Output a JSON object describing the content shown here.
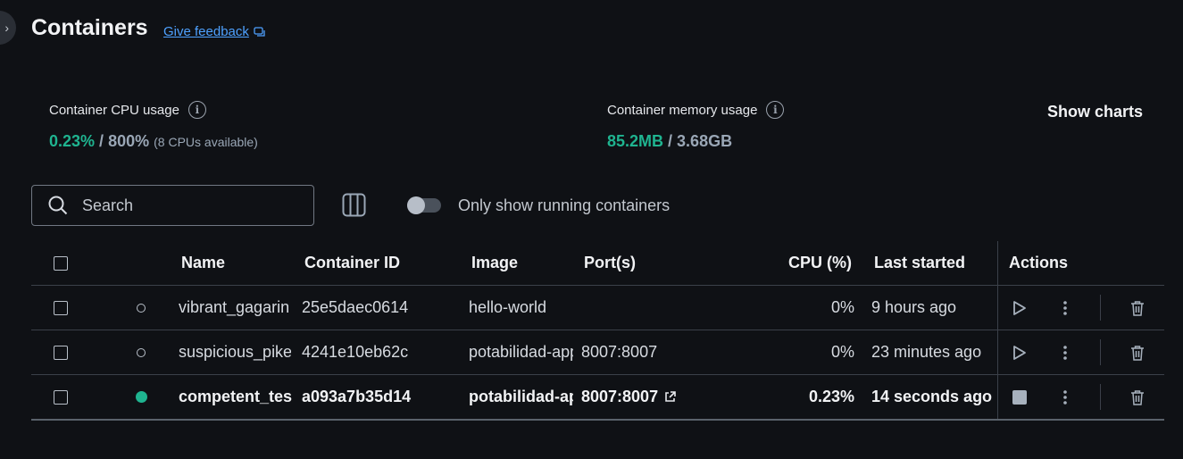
{
  "header": {
    "title": "Containers",
    "feedback_label": "Give feedback"
  },
  "stats": {
    "cpu": {
      "label": "Container CPU usage",
      "used": "0.23%",
      "separator": " / ",
      "total": "800%",
      "note": "(8 CPUs available)"
    },
    "memory": {
      "label": "Container memory usage",
      "used": "85.2MB",
      "separator": " / ",
      "total": "3.68GB"
    },
    "show_charts_label": "Show charts"
  },
  "toolbar": {
    "search_placeholder": "Search",
    "toggle_label": "Only show running containers",
    "toggle_on": false
  },
  "table": {
    "columns": {
      "name": "Name",
      "container_id": "Container ID",
      "image": "Image",
      "ports": "Port(s)",
      "cpu": "CPU (%)",
      "last_started": "Last started",
      "actions": "Actions"
    },
    "rows": [
      {
        "name": "vibrant_gagarin",
        "container_id": "25e5daec0614",
        "image": "hello-world",
        "ports": "",
        "cpu": "0%",
        "last_started": "9 hours ago",
        "running": false
      },
      {
        "name": "suspicious_pike",
        "container_id": "4241e10eb62c",
        "image": "potabilidad-app",
        "ports": "8007:8007",
        "cpu": "0%",
        "last_started": "23 minutes ago",
        "running": false
      },
      {
        "name": "competent_tesla",
        "container_id": "a093a7b35d14",
        "image": "potabilidad-app",
        "ports": "8007:8007",
        "cpu": "0.23%",
        "last_started": "14 seconds ago",
        "running": true
      }
    ]
  },
  "colors": {
    "background": "#0f1115",
    "accent_green": "#1fb490",
    "link_blue": "#4ea1ff"
  }
}
